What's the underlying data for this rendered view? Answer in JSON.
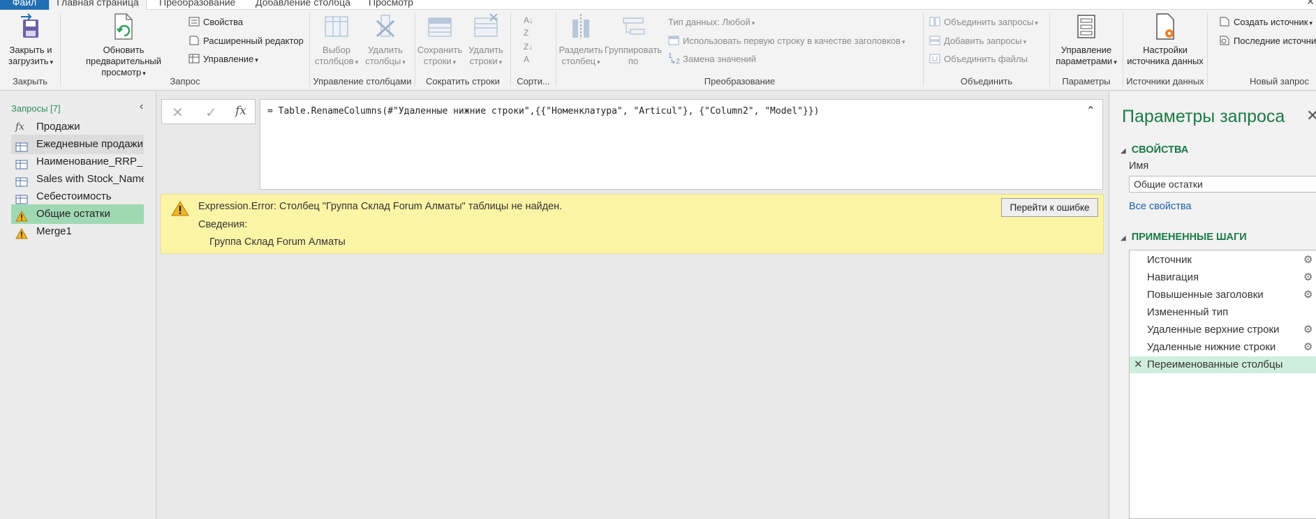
{
  "tabs": {
    "file": "Файл",
    "home": "Главная страница",
    "transform": "Преобразование",
    "add_column": "Добавление столбца",
    "view": "Просмотр"
  },
  "ribbon": {
    "close_group": {
      "label": "Закрыть",
      "close_load": "Закрыть и\nзагрузить"
    },
    "query_group": {
      "label": "Запрос",
      "refresh_preview": "Обновить предварительный\nпросмотр",
      "properties": "Свойства",
      "advanced_editor": "Расширенный редактор",
      "manage": "Управление"
    },
    "manage_columns_group": {
      "label": "Управление столбцами",
      "choose_columns": "Выбор\nстолбцов",
      "remove_columns": "Удалить\nстолбцы"
    },
    "reduce_rows_group": {
      "label": "Сократить строки",
      "keep_rows": "Сохранить\nстроки",
      "remove_rows": "Удалить\nстроки"
    },
    "sort_group": {
      "label": "Сорти..."
    },
    "transform_group": {
      "label": "Преобразование",
      "split_column": "Разделить\nстолбец",
      "group_by": "Группировать\nпо",
      "data_type": "Тип данных: Любой",
      "use_first_row": "Использовать первую строку в качестве заголовков",
      "replace_values": "Замена значений"
    },
    "combine_group": {
      "label": "Объединить",
      "merge_queries": "Объединить запросы",
      "append_queries": "Добавить запросы",
      "combine_files": "Объединить файлы"
    },
    "parameters_group": {
      "label": "Параметры",
      "manage_parameters": "Управление\nпараметрами"
    },
    "data_sources_group": {
      "label": "Источники данных",
      "data_source_settings": "Настройки\nисточника данных"
    },
    "new_query_group": {
      "label": "Новый запрос",
      "new_source": "Создать источник",
      "recent_sources": "Последние источни"
    }
  },
  "queries_pane": {
    "title": "Запросы [7]",
    "items": [
      {
        "label": "Продажи",
        "icon": "fx-icon"
      },
      {
        "label": "Ежедневные продажи",
        "icon": "table-icon"
      },
      {
        "label": "Наименование_RRP_...",
        "icon": "table-icon"
      },
      {
        "label": "Sales with Stock_Name",
        "icon": "table-icon"
      },
      {
        "label": "Себестоимость",
        "icon": "table-icon"
      },
      {
        "label": "Общие остатки",
        "icon": "warning-icon"
      },
      {
        "label": "Merge1",
        "icon": "warning-icon"
      }
    ]
  },
  "formula_bar": {
    "fx": "fx",
    "formula": "= Table.RenameColumns(#\"Удаленные нижние строки\",{{\"Номенклатура\", \"Articul\"}, {\"Column2\", \"Model\"}})"
  },
  "error": {
    "message": "Expression.Error: Столбец \"Группа Склад Forum Алматы\" таблицы не найден.",
    "details_label": "Сведения:",
    "details_value": "Группа Склад Forum Алматы",
    "goto_button": "Перейти к ошибке",
    "color": "#fdf5a6"
  },
  "settings_pane": {
    "title": "Параметры запроса",
    "properties_section": "СВОЙСТВА",
    "name_label": "Имя",
    "name_value": "Общие остатки",
    "all_properties": "Все свойства",
    "steps_section": "ПРИМЕНЕННЫЕ ШАГИ",
    "steps": [
      {
        "label": "Источник",
        "gear": true
      },
      {
        "label": "Навигация",
        "gear": true
      },
      {
        "label": "Повышенные заголовки",
        "gear": true
      },
      {
        "label": "Измененный тип",
        "gear": false
      },
      {
        "label": "Удаленные верхние строки",
        "gear": true
      },
      {
        "label": "Удаленные нижние строки",
        "gear": true
      },
      {
        "label": "Переименованные столбцы",
        "gear": false,
        "selected": true
      }
    ]
  },
  "colors": {
    "accent_green": "#1a7a45",
    "selected_query": "#9fd9b3",
    "selected_step": "#cfeedd",
    "file_tab": "#1f6fb4"
  }
}
